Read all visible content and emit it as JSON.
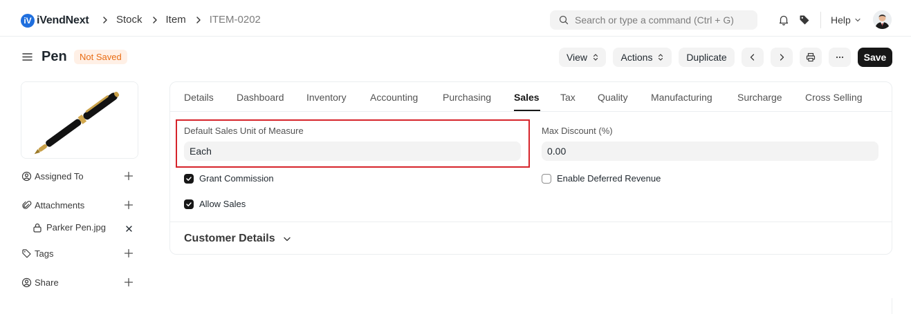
{
  "app": {
    "logo_text": "iVendNext"
  },
  "breadcrumbs": [
    "Stock",
    "Item",
    "ITEM-0202"
  ],
  "search": {
    "placeholder": "Search or type a command (Ctrl + G)"
  },
  "navbar": {
    "help_label": "Help"
  },
  "page": {
    "title": "Pen",
    "status": "Not Saved"
  },
  "toolbar": {
    "view_label": "View",
    "actions_label": "Actions",
    "duplicate_label": "Duplicate",
    "save_label": "Save"
  },
  "sidebar": {
    "assigned_to": "Assigned To",
    "attachments": "Attachments",
    "attachment_file": "Parker Pen.jpg",
    "tags": "Tags",
    "share": "Share"
  },
  "tabs": [
    {
      "label": "Details",
      "active": false
    },
    {
      "label": "Dashboard",
      "active": false
    },
    {
      "label": "Inventory",
      "active": false
    },
    {
      "label": "Accounting",
      "active": false
    },
    {
      "label": "Purchasing",
      "active": false
    },
    {
      "label": "Sales",
      "active": true
    },
    {
      "label": "Tax",
      "active": false
    },
    {
      "label": "Quality",
      "active": false
    },
    {
      "label": "Manufacturing",
      "active": false
    },
    {
      "label": "Surcharge",
      "active": false
    },
    {
      "label": "Cross Selling",
      "active": false
    }
  ],
  "form": {
    "default_sales_uom": {
      "label": "Default Sales Unit of Measure",
      "value": "Each"
    },
    "max_discount": {
      "label": "Max Discount (%)",
      "value": "0.00"
    },
    "grant_commission": {
      "label": "Grant Commission",
      "checked": true
    },
    "allow_sales": {
      "label": "Allow Sales",
      "checked": true
    },
    "enable_deferred_revenue": {
      "label": "Enable Deferred Revenue",
      "checked": false
    }
  },
  "sections": {
    "customer_details": "Customer Details"
  },
  "icons": {
    "logo": "ivend-logo-icon",
    "search": "search-icon",
    "bell": "bell-icon",
    "tag": "tag-icon",
    "menu": "hamburger-icon",
    "prev": "chevron-left-icon",
    "next": "chevron-right-icon",
    "print": "printer-icon",
    "more": "ellipsis-icon"
  },
  "colors": {
    "brand": "#1f6fde",
    "status_text": "#e86c13",
    "status_bg": "#fff0e6",
    "highlight": "#d6232a",
    "primary_button": "#171717"
  }
}
